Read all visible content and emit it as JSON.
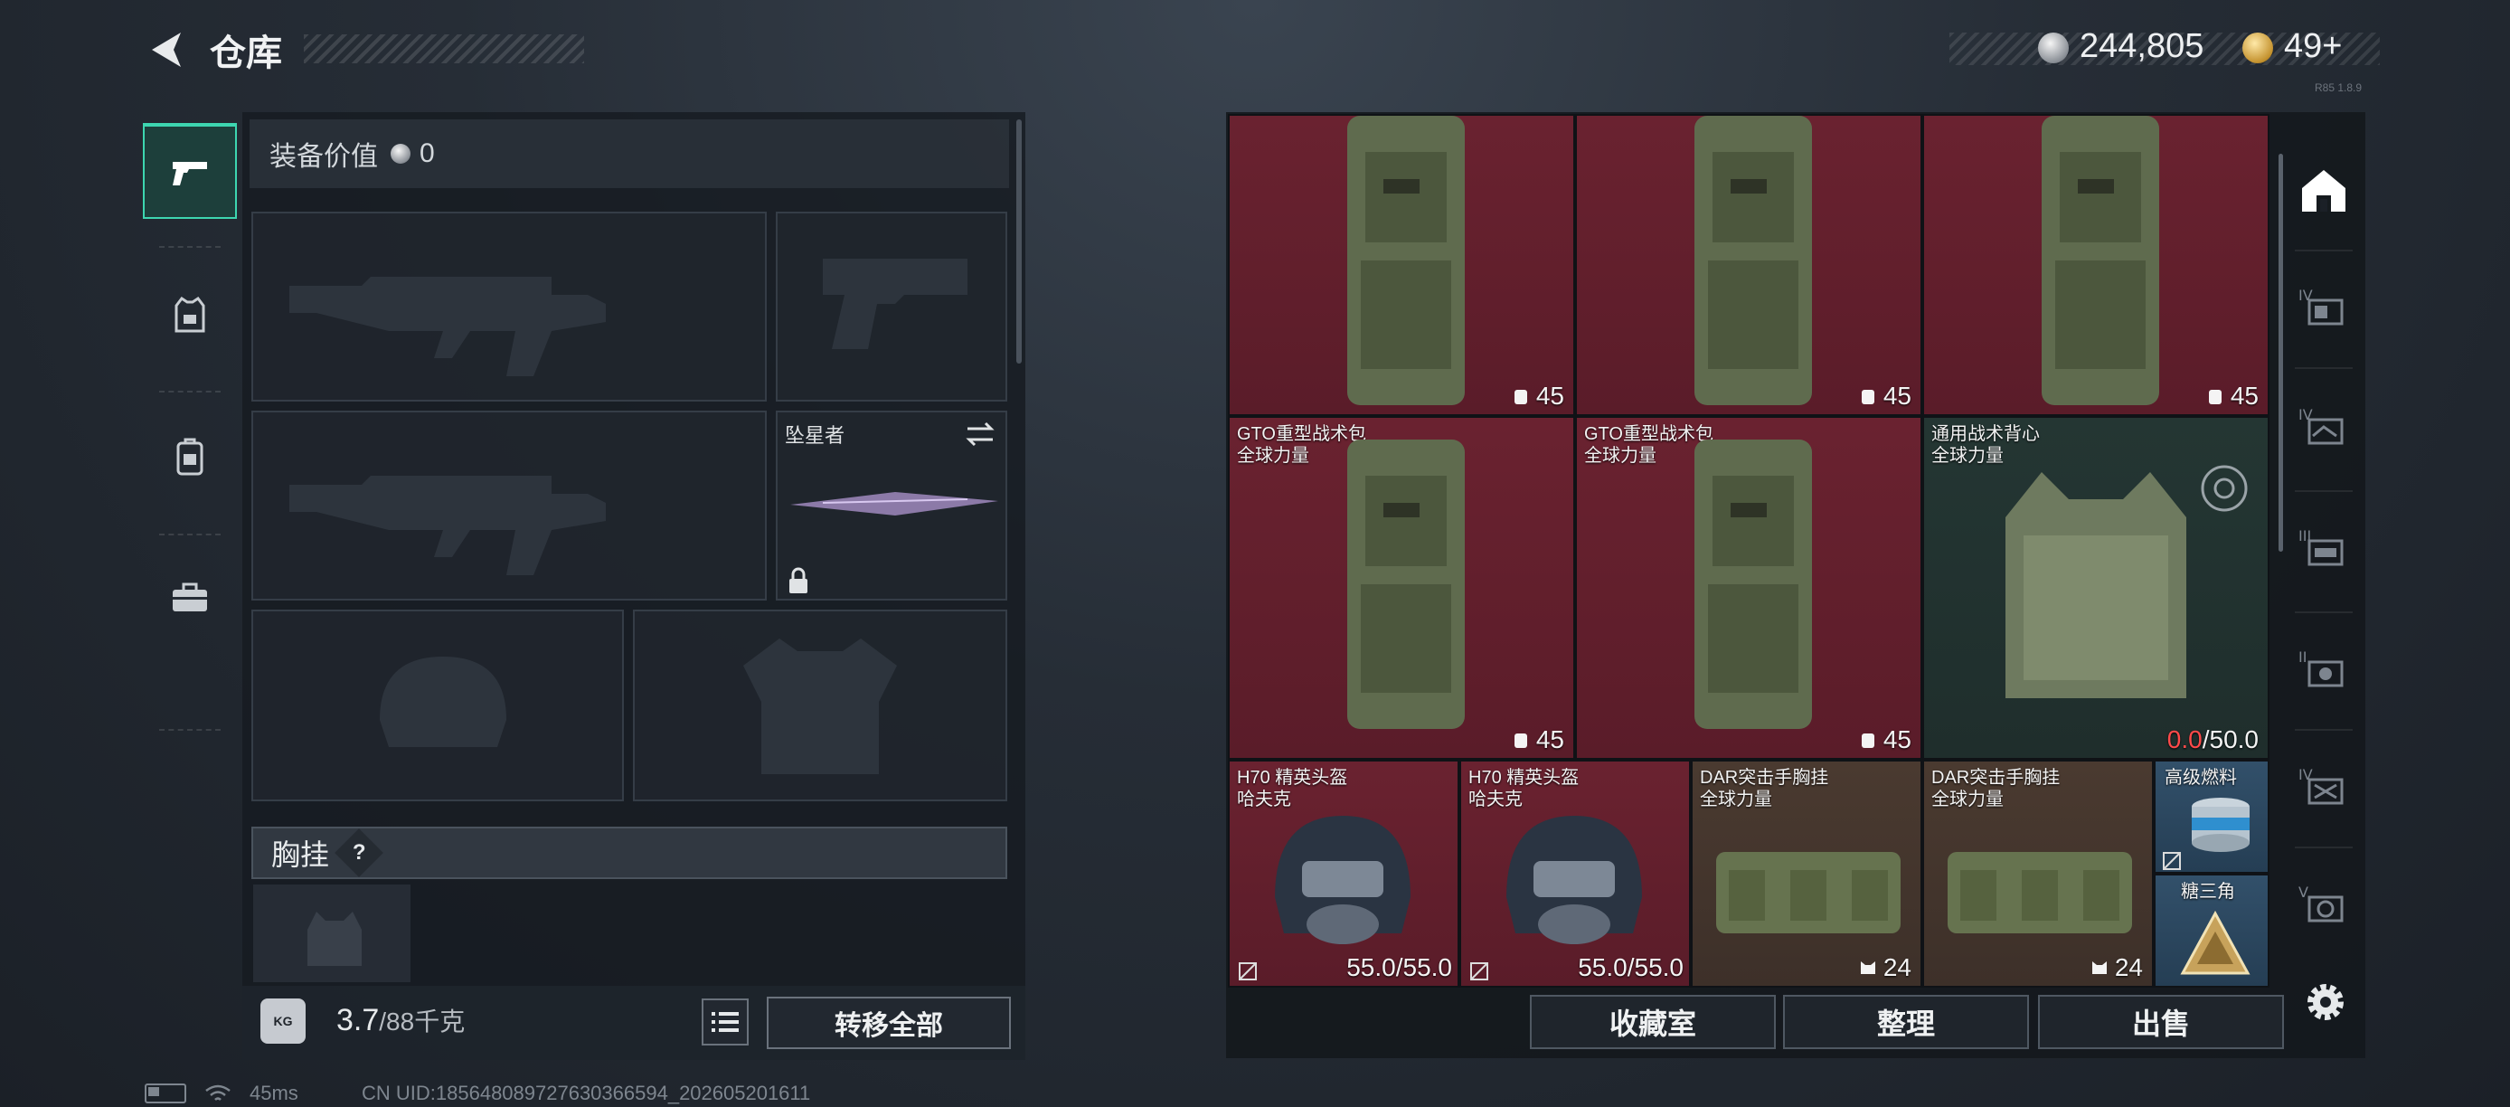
{
  "header": {
    "title": "仓库",
    "currency_silver": "244,805",
    "currency_gold": "49+",
    "version_text": "R85 1.8.9"
  },
  "left_tabs": [
    {
      "name": "weapons",
      "icon": "pistol-icon",
      "active": true
    },
    {
      "name": "armor",
      "icon": "armor-vest-icon",
      "active": false
    },
    {
      "name": "backpack",
      "icon": "backpack-icon",
      "active": false
    },
    {
      "name": "toolbox",
      "icon": "toolbox-icon",
      "active": false
    }
  ],
  "equipment": {
    "value_label": "装备价值",
    "value": "0",
    "melee_name": "坠星者",
    "chest_rig_label": "胸挂",
    "chest_rig_help": "?"
  },
  "footer_left": {
    "weight_current": "3.7",
    "weight_max": "/88千克",
    "weight_icon_label": "KG",
    "transfer_all": "转移全部"
  },
  "grid": {
    "row1": [
      {
        "count": "45"
      },
      {
        "count": "45"
      },
      {
        "count": "45"
      }
    ],
    "row2": [
      {
        "name": "GTO重型战术包",
        "sub": "全球力量",
        "count": "45"
      },
      {
        "name": "GTO重型战术包",
        "sub": "全球力量",
        "count": "45"
      },
      {
        "name": "通用战术背心",
        "sub": "全球力量",
        "dur_cur": "0.0",
        "dur_max": "/50.0"
      }
    ],
    "row3": [
      {
        "name": "H70 精英头盔",
        "sub": "哈夫克",
        "dur": "55.0/55.0"
      },
      {
        "name": "H70 精英头盔",
        "sub": "哈夫克",
        "dur": "55.0/55.0"
      },
      {
        "name": "DAR突击手胸挂",
        "sub": "全球力量",
        "count": "24"
      },
      {
        "name": "DAR突击手胸挂",
        "sub": "全球力量",
        "count": "24"
      },
      {
        "name": "高级燃料"
      },
      {
        "name": "糖三角"
      }
    ]
  },
  "bottom_buttons": {
    "collection": "收藏室",
    "organize": "整理",
    "sell": "出售"
  },
  "status_bar": {
    "ping": "45ms",
    "uid": "CN UID:18564808972763036659​4_202605201611"
  },
  "colors": {
    "accent": "#3dd6b0",
    "red_cell": "#5a1c29",
    "green_cell": "#1f2e2c",
    "brown_cell": "#3d3029",
    "blue_cell": "#253e54",
    "durability_low": "#ff4a4a"
  }
}
